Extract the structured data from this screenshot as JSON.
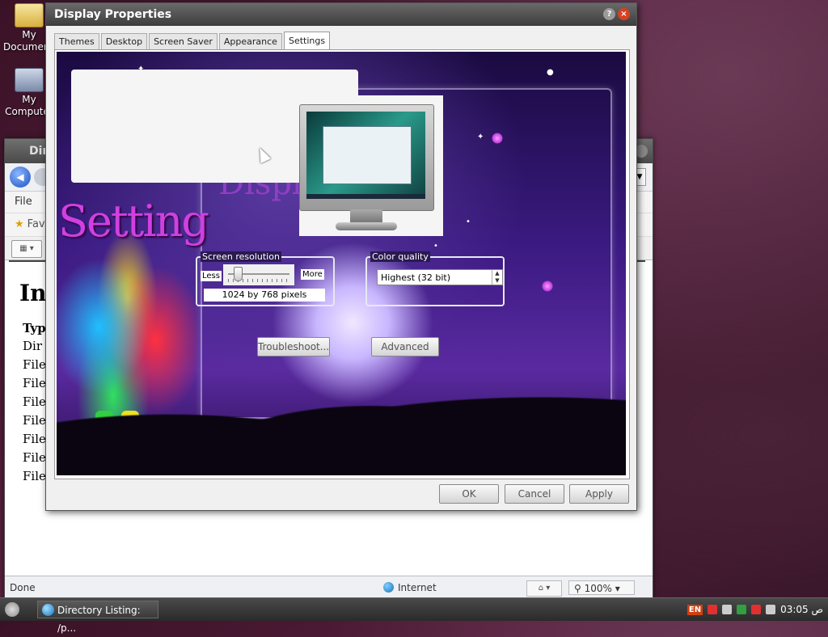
{
  "desktop": {
    "icons": [
      {
        "label": "My Documents"
      },
      {
        "label": "My Computer"
      }
    ]
  },
  "browser": {
    "title": "Dir",
    "menu_file": "File",
    "favorites": "Fav",
    "heading": "Ind",
    "column_header": "Type",
    "rows": [
      "Dir",
      "File",
      "File",
      "File",
      "File",
      "File",
      "File",
      "File"
    ],
    "status_done": "Done",
    "status_zone": "Internet",
    "zoom": "100%"
  },
  "dialog": {
    "title": "Display Properties",
    "help_label": "?",
    "close_label": "×",
    "tabs": [
      "Themes",
      "Desktop",
      "Screen Saver",
      "Appearance",
      "Settings"
    ],
    "active_tab": "Settings",
    "art_text_setting": "Setting",
    "art_text_display": "Displ",
    "screen_resolution": {
      "legend": "Screen resolution",
      "less": "Less",
      "more": "More",
      "value": "1024 by 768 pixels",
      "slider_fraction": 0.1
    },
    "color_quality": {
      "legend": "Color quality",
      "selected": "Highest (32 bit)"
    },
    "troubleshoot": "Troubleshoot...",
    "advanced": "Advanced",
    "ok": "OK",
    "cancel": "Cancel",
    "apply": "Apply"
  },
  "taskbar": {
    "task_label": "Directory Listing: /p...",
    "lang": "EN",
    "clock": "03:05 ص"
  }
}
